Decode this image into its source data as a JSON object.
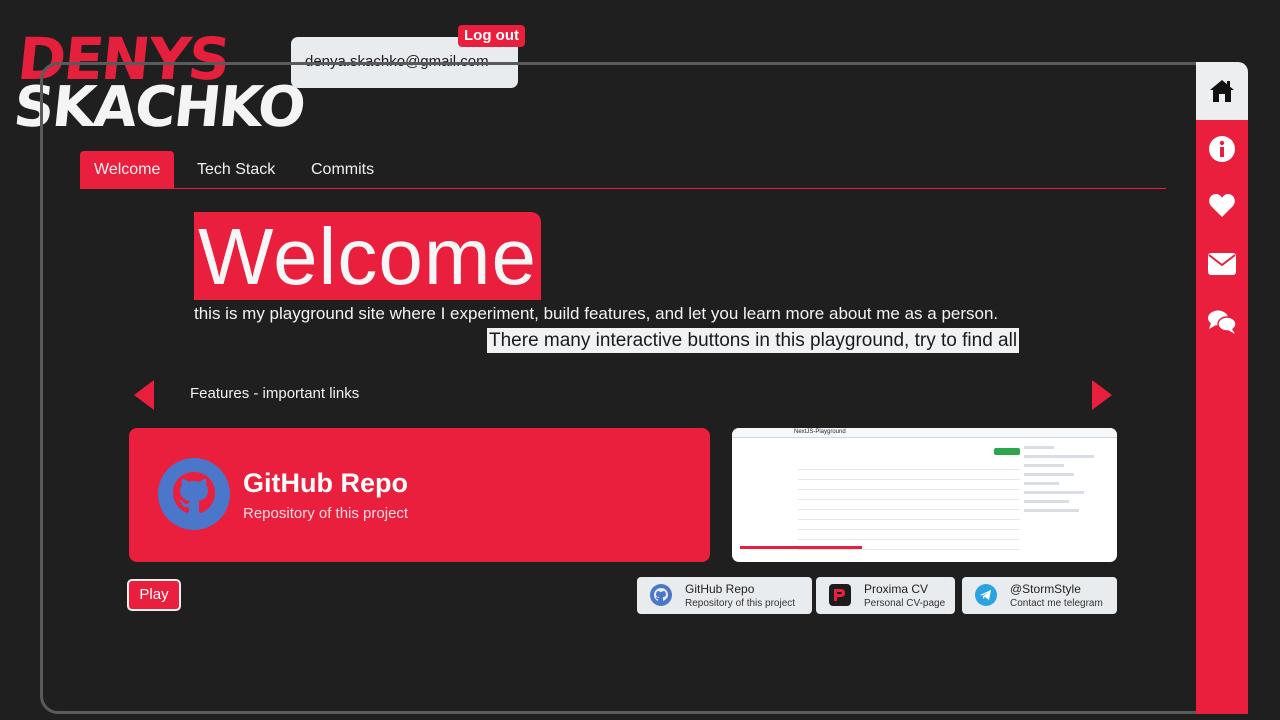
{
  "logo": {
    "line1": "DENYS",
    "line2": "SKACHKO"
  },
  "account": {
    "email": "denya.skachko@gmail.com",
    "logout_label": "Log out"
  },
  "sidebar": {
    "items": [
      {
        "icon": "home-icon",
        "active": true
      },
      {
        "icon": "info-icon"
      },
      {
        "icon": "heart-icon"
      },
      {
        "icon": "envelope-icon"
      },
      {
        "icon": "chat-icon"
      }
    ]
  },
  "tabs": [
    {
      "label": "Welcome",
      "active": true
    },
    {
      "label": "Tech Stack"
    },
    {
      "label": "Commits"
    }
  ],
  "hero": {
    "title": "Welcome",
    "subtitle": "this is my playground site where I experiment, build features, and let you learn more about me as a person.",
    "note": "There many interactive buttons in this playground, try to find all"
  },
  "features": {
    "title": "Features - important links",
    "card": {
      "icon": "github-icon",
      "title": "GitHub Repo",
      "description": "Repository of this project"
    },
    "preview": {
      "repo_name": "NextJS-Playground",
      "progress": 0.33
    }
  },
  "play_label": "Play",
  "links": [
    {
      "icon": "github-icon",
      "title": "GitHub Repo",
      "description": "Repository of this project"
    },
    {
      "icon": "proxima-cv-icon",
      "title": "Proxima CV",
      "description": "Personal CV-page"
    },
    {
      "icon": "telegram-icon",
      "title": "@StormStyle",
      "description": "Contact me telegram"
    }
  ],
  "colors": {
    "accent": "#ea1f3e",
    "background": "#1f1f20",
    "light": "#e9ecef"
  }
}
